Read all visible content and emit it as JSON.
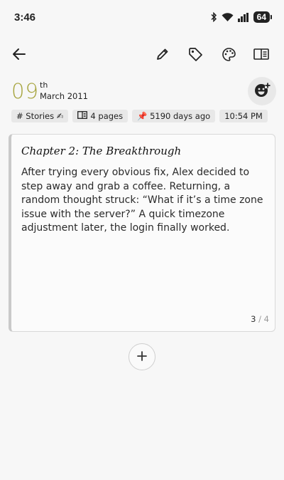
{
  "status": {
    "time": "3:46",
    "battery": "64"
  },
  "toolbar": {
    "back_icon": "arrow-left-icon",
    "edit_icon": "pencil-icon",
    "tag_icon": "tag-icon",
    "palette_icon": "palette-icon",
    "reader_icon": "book-open-icon"
  },
  "entry": {
    "day": "09",
    "day_suffix": "th",
    "month_year": "March 2011",
    "mood_icon": "emoji-add-icon",
    "chips": {
      "tag": "# Stories ✍",
      "pages": "4 pages",
      "age": "📌 5190 days ago",
      "time": "10:54 PM"
    }
  },
  "page": {
    "title": "Chapter 2: The Breakthrough",
    "body": "After trying every obvious fix, Alex decided to step away and grab a coffee. Returning, a random thought struck: “What if it’s a time zone issue with the server?” A quick timezone adjustment later, the login finally worked.",
    "current": "3",
    "separator": "/",
    "total": "4"
  },
  "add_page": {
    "icon": "plus-icon"
  },
  "colors": {
    "accent": "#a6a43d",
    "background": "#f7f7f7",
    "chip": "#e8e8e8"
  }
}
